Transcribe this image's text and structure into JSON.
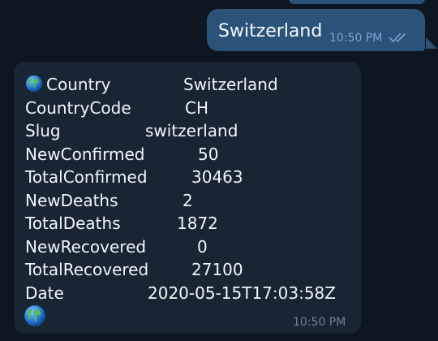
{
  "outgoing": {
    "text": "Switzerland",
    "time": "10:50 PM",
    "status_icon": "double-check-icon"
  },
  "incoming": {
    "header_icon": "globe-icon",
    "rows": [
      {
        "key": "Country",
        "value": "Switzerland"
      },
      {
        "key": "CountryCode",
        "value": "CH"
      },
      {
        "key": "Slug",
        "value": "switzerland"
      },
      {
        "key": "NewConfirmed",
        "value": "50"
      },
      {
        "key": "TotalConfirmed",
        "value": "30463"
      },
      {
        "key": "NewDeaths",
        "value": "2"
      },
      {
        "key": "TotalDeaths",
        "value": "1872"
      },
      {
        "key": "NewRecovered",
        "value": "0"
      },
      {
        "key": "TotalRecovered",
        "value": "27100"
      },
      {
        "key": "Date",
        "value": "2020-05-15T17:03:58Z"
      }
    ],
    "footer_icon": "globe-icon",
    "time": "10:50 PM"
  },
  "colors": {
    "chat_background": "#0e1621",
    "outgoing_bubble": "#2b5278",
    "incoming_bubble": "#182533",
    "accent_time": "#7aa7cf",
    "muted_time": "#6e8192"
  }
}
